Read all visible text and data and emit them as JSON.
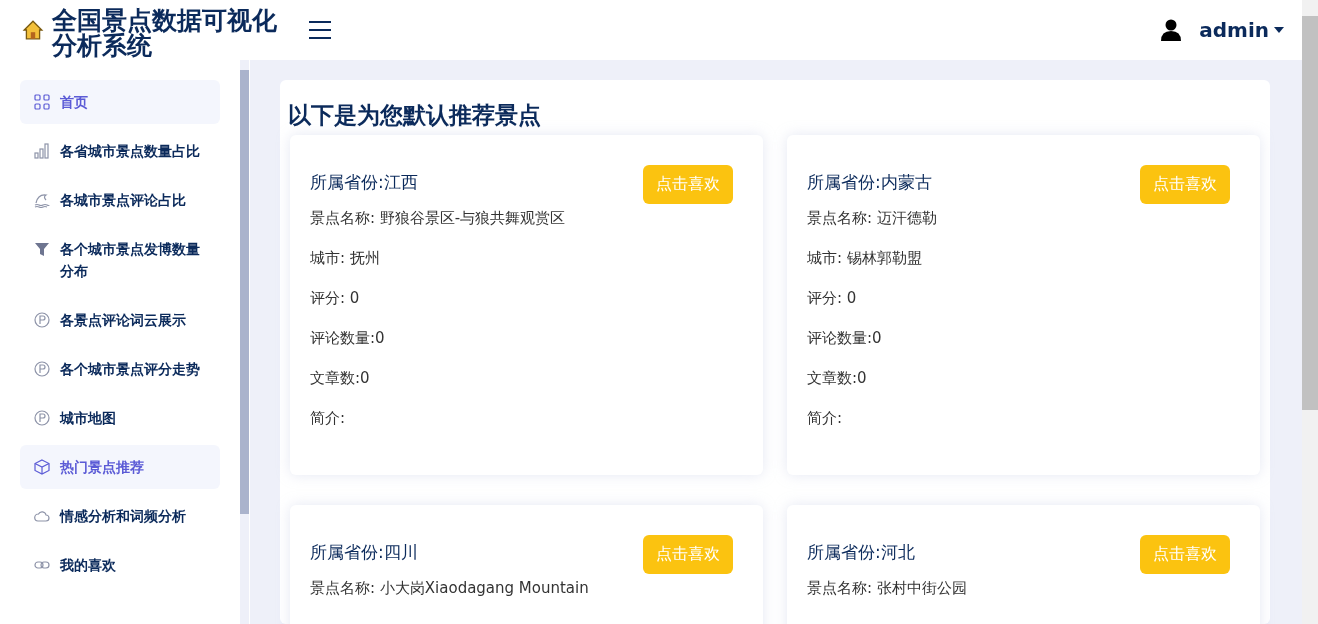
{
  "header": {
    "title_lines": [
      "全国景点数据可视化",
      "分析系统"
    ],
    "user": "admin"
  },
  "sidebar": {
    "items": [
      {
        "label": "首页",
        "selected": true
      },
      {
        "label": "各省城市景点数量占比",
        "selected": false
      },
      {
        "label": "各城市景点评论占比",
        "selected": false
      },
      {
        "label": "各个城市景点发博数量分布",
        "selected": false
      },
      {
        "label": "各景点评论词云展示",
        "selected": false
      },
      {
        "label": "各个城市景点评分走势",
        "selected": false
      },
      {
        "label": "城市地图",
        "selected": false
      },
      {
        "label": "热门景点推荐",
        "selected": true
      },
      {
        "label": "情感分析和词频分析",
        "selected": false
      },
      {
        "label": "我的喜欢",
        "selected": false
      }
    ]
  },
  "main": {
    "heading": "以下是为您默认推荐景点",
    "cards": [
      {
        "title": "所属省份:江西",
        "button": "点击喜欢",
        "fields": [
          "景点名称: 野狼谷景区-与狼共舞观赏区",
          "城市: 抚州",
          "评分: 0",
          "评论数量:0",
          "文章数:0",
          "简介:"
        ]
      },
      {
        "title": "所属省份:内蒙古",
        "button": "点击喜欢",
        "fields": [
          "景点名称: 迈汗德勒",
          "城市: 锡林郭勒盟",
          "评分: 0",
          "评论数量:0",
          "文章数:0",
          "简介:"
        ]
      },
      {
        "title": "所属省份:四川",
        "button": "点击喜欢",
        "fields": [
          "景点名称: 小大岗Xiaodagang Mountain"
        ]
      },
      {
        "title": "所属省份:河北",
        "button": "点击喜欢",
        "fields": [
          "景点名称: 张村中街公园"
        ]
      }
    ]
  }
}
